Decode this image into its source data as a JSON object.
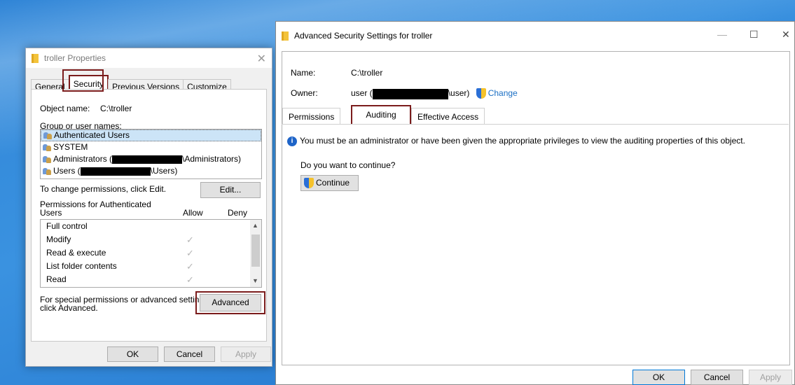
{
  "properties_dialog": {
    "title": "troller Properties",
    "close_glyph": "✕",
    "tabs": [
      "General",
      "Security",
      "Previous Versions",
      "Customize"
    ],
    "active_tab": "Security",
    "object_name_label": "Object name:",
    "object_name_value": "C:\\troller",
    "group_label": "Group or user names:",
    "users": [
      {
        "prefix": "Authenticated Users",
        "suffix": ""
      },
      {
        "prefix": "SYSTEM",
        "suffix": ""
      },
      {
        "prefix": "Administrators (",
        "suffix": "\\Administrators)"
      },
      {
        "prefix": "Users (",
        "suffix": "\\Users)"
      }
    ],
    "change_text": "To change permissions, click Edit.",
    "edit_button": "Edit...",
    "perm_header": "Permissions for Authenticated Users",
    "perm_header_line1": "Permissions for Authenticated",
    "perm_header_line2": "Users",
    "allow_label": "Allow",
    "deny_label": "Deny",
    "permissions": [
      {
        "name": "Full control",
        "allow": false
      },
      {
        "name": "Modify",
        "allow": true
      },
      {
        "name": "Read & execute",
        "allow": true
      },
      {
        "name": "List folder contents",
        "allow": true
      },
      {
        "name": "Read",
        "allow": true
      }
    ],
    "special_line1": "For special permissions or advanced settings,",
    "special_line2": "click Advanced.",
    "advanced_button": "Advanced",
    "ok_button": "OK",
    "cancel_button": "Cancel",
    "apply_button": "Apply"
  },
  "advanced_dialog": {
    "title": "Advanced Security Settings for troller",
    "minimize_glyph": "—",
    "maximize_glyph": "☐",
    "close_glyph": "✕",
    "name_label": "Name:",
    "name_value": "C:\\troller",
    "owner_label": "Owner:",
    "owner_prefix": "user (",
    "owner_suffix": "\\user)",
    "change_link": "Change",
    "tabs": [
      "Permissions",
      "Auditing",
      "Effective Access"
    ],
    "active_tab": "Auditing",
    "info_message": "You must be an administrator or have been given the appropriate privileges to view the auditing properties of this object.",
    "question": "Do you want to continue?",
    "continue_button": "Continue",
    "ok_button": "OK",
    "cancel_button": "Cancel",
    "apply_button": "Apply"
  },
  "colors": {
    "highlight_box": "#7b1c1c",
    "link": "#1a6fc4",
    "selection": "#cce4f7"
  }
}
